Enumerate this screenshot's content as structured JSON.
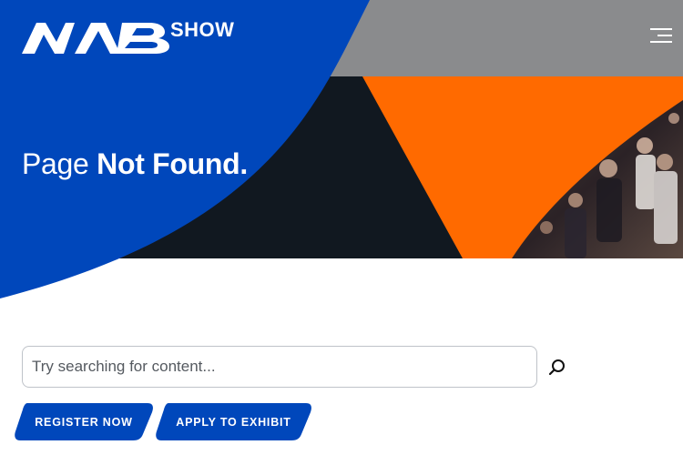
{
  "header": {
    "logo_text": "NAB",
    "logo_suffix": "SHOW",
    "menu_icon": "hamburger-menu-icon"
  },
  "hero": {
    "title_light": "Page",
    "title_bold": "Not Found.",
    "colors": {
      "blue": "#0047BB",
      "orange": "#FF6A00",
      "dark": "#111820",
      "gray": "#8A8B8D"
    }
  },
  "search": {
    "placeholder": "Try searching for content...",
    "value": "",
    "icon": "search-icon"
  },
  "actions": {
    "register_label": "REGISTER NOW",
    "exhibit_label": "APPLY TO EXHIBIT"
  }
}
